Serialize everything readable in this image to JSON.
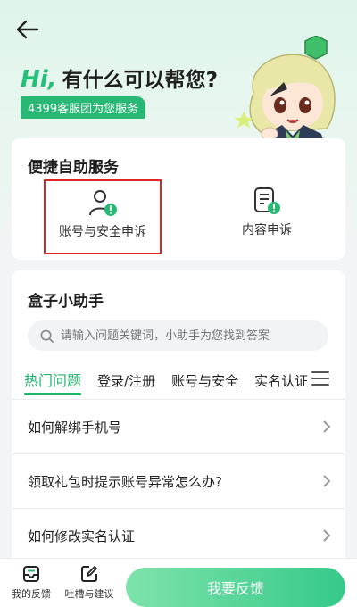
{
  "header": {
    "hi": "Hi,",
    "title": "有什么可以帮您?",
    "badge": "4399客服团为您服务"
  },
  "quick_services": {
    "title": "便捷自助服务",
    "items": [
      {
        "label": "账号与安全申诉",
        "icon": "user-alert-icon"
      },
      {
        "label": "内容申诉",
        "icon": "document-alert-icon"
      }
    ]
  },
  "helper": {
    "title": "盒子小助手",
    "search_placeholder": "请输入问题关键词，小助手为您找到答案",
    "tabs": [
      "热门问题",
      "登录/注册",
      "账号与安全",
      "实名认证"
    ],
    "questions": [
      "如何解绑手机号",
      "领取礼包时提示账号异常怎么办?",
      "如何修改实名认证"
    ]
  },
  "bottom_bar": {
    "my_feedback": "我的反馈",
    "suggestions": "吐槽与建议",
    "feedback_button": "我要反馈"
  },
  "colors": {
    "accent": "#1fb36c",
    "highlight": "#e02424"
  }
}
